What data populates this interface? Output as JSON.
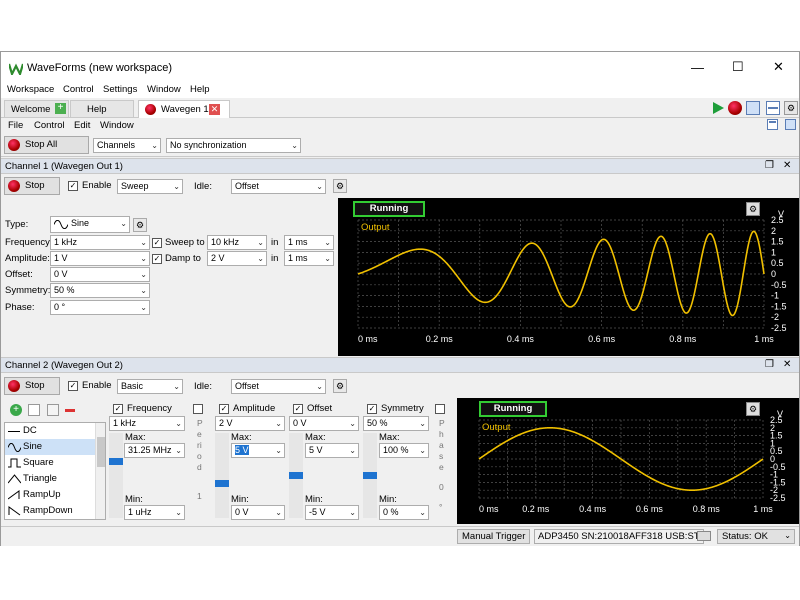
{
  "window": {
    "title": "WaveForms (new workspace)",
    "controls": [
      "—",
      "☐",
      "✕"
    ]
  },
  "menu": [
    "Workspace",
    "Control",
    "Settings",
    "Window",
    "Help"
  ],
  "tabs": {
    "welcome": "Welcome",
    "help": "Help",
    "wavegen": "Wavegen 1"
  },
  "submenu": [
    "File",
    "Control",
    "Edit",
    "Window"
  ],
  "toolbar": {
    "stop_all": "Stop All",
    "channels": "Channels",
    "sync": "No synchronization"
  },
  "ch1": {
    "header": "Channel 1 (Wavegen Out 1)",
    "stop": "Stop",
    "enable": "Enable",
    "mode": "Sweep",
    "idle_label": "Idle:",
    "idle": "Offset",
    "type_label": "Type:",
    "type": "Sine",
    "frequency_label": "Frequency:",
    "frequency": "1 kHz",
    "amplitude_label": "Amplitude:",
    "amplitude": "1 V",
    "offset_label": "Offset:",
    "offset": "0 V",
    "symmetry_label": "Symmetry:",
    "symmetry": "50 %",
    "phase_label": "Phase:",
    "phase": "0 °",
    "sweep_label": "Sweep to",
    "sweep_to": "10 kHz",
    "in_label": "in",
    "sweep_in": "1 ms",
    "damp_label": "Damp to",
    "damp_to": "2 V",
    "damp_in": "1 ms",
    "plot": {
      "status": "Running",
      "legend": "Output",
      "unit": "V",
      "y_ticks": [
        "2.5",
        "2",
        "1.5",
        "1",
        "0.5",
        "0",
        "-0.5",
        "-1",
        "-1.5",
        "-2",
        "-2.5"
      ],
      "x_ticks": [
        "0 ms",
        "0.2 ms",
        "0.4 ms",
        "0.6 ms",
        "0.8 ms",
        "1 ms"
      ]
    }
  },
  "ch2": {
    "header": "Channel 2 (Wavegen Out 2)",
    "stop": "Stop",
    "enable": "Enable",
    "mode": "Basic",
    "idle_label": "Idle:",
    "idle": "Offset",
    "waveforms": [
      "DC",
      "Sine",
      "Square",
      "Triangle",
      "RampUp",
      "RampDown"
    ],
    "selected_waveform": "Sine",
    "frequency_label": "Frequency",
    "frequency": "1 kHz",
    "freq_max": "31.25 MHz",
    "freq_min": "1 uHz",
    "period_label": "Period",
    "period_value": "1",
    "amplitude_label": "Amplitude",
    "amplitude": "2 V",
    "amp_max": "5 V",
    "amp_min": "0 V",
    "offset_label": "Offset",
    "offset": "0 V",
    "off_max": "5 V",
    "off_min": "-5 V",
    "symmetry_label": "Symmetry",
    "symmetry": "50 %",
    "sym_max": "100 %",
    "sym_min": "0 %",
    "phase_label": "Phase",
    "phase_value": "0",
    "phase_unit": "°",
    "max_label": "Max:",
    "min_label": "Min:",
    "plot": {
      "status": "Running",
      "legend": "Output",
      "unit": "V",
      "y_ticks": [
        "2.5",
        "2",
        "1.5",
        "1",
        "0.5",
        "0",
        "-0.5",
        "-1",
        "-1.5",
        "-2",
        "-2.5"
      ],
      "x_ticks": [
        "0 ms",
        "0.2 ms",
        "0.4 ms",
        "0.6 ms",
        "0.8 ms",
        "1 ms"
      ]
    }
  },
  "status": {
    "trigger": "Manual Trigger",
    "device": "ADP3450 SN:210018AFF318 USB:ST",
    "state": "Status: OK"
  },
  "colors": {
    "trace": "#f0c000",
    "grid": "#555555",
    "running_border": "#33cc33",
    "header_bg": "#dde3ec"
  }
}
